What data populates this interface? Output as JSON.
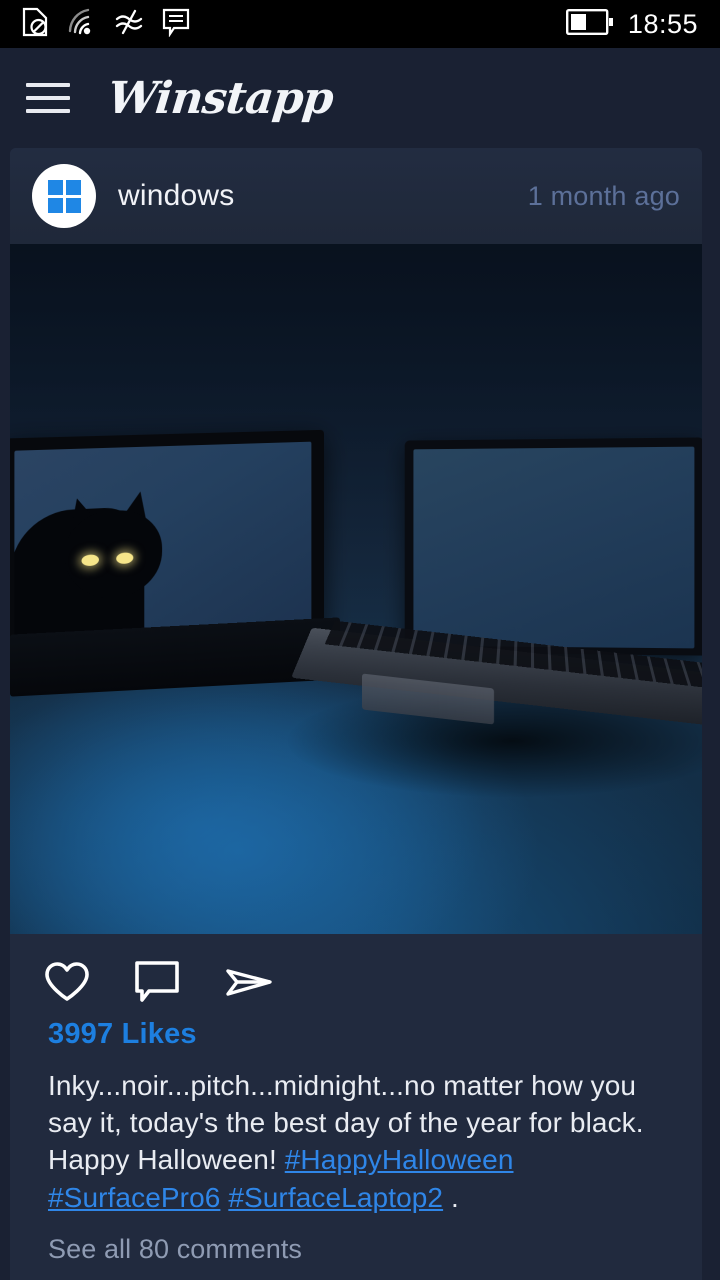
{
  "status_bar": {
    "icons": [
      "no-sim-icon",
      "wifi-icon",
      "cellular-data-icon",
      "message-icon"
    ],
    "battery": {
      "icon": "battery-icon",
      "level_percent": 42
    },
    "clock": "18:55"
  },
  "app_bar": {
    "menu_icon": "hamburger-menu-icon",
    "brand": "Winstapp"
  },
  "post": {
    "avatar_icon": "windows-logo-icon",
    "username": "windows",
    "timestamp": "1 month ago",
    "photo": {
      "alt": "Dark blue night scene with a black cat with glowing eyes behind a Surface Studio and a Surface Laptop on a desk"
    },
    "actions": [
      {
        "name": "like-button",
        "icon": "heart-icon"
      },
      {
        "name": "comment-button",
        "icon": "comment-bubble-icon"
      },
      {
        "name": "share-button",
        "icon": "paper-plane-icon"
      }
    ],
    "likes": "3997 Likes",
    "caption_parts": [
      {
        "type": "text",
        "value": "Inky...noir...pitch...midnight...no matter how you say it, today's the best day of the year for black. Happy Halloween! "
      },
      {
        "type": "hashtag",
        "value": "#HappyHalloween"
      },
      {
        "type": "text",
        "value": " "
      },
      {
        "type": "hashtag",
        "value": "#SurfacePro6"
      },
      {
        "type": "text",
        "value": " "
      },
      {
        "type": "hashtag",
        "value": "#SurfaceLaptop2"
      },
      {
        "type": "text",
        "value": " ."
      }
    ],
    "caption_plain": "Inky...noir...pitch...midnight...no matter how you say it, today's the best day of the year for black. Happy Halloween! #HappyHalloween #SurfacePro6 #SurfaceLaptop2 .",
    "comments_link": "See all 80 comments"
  },
  "colors": {
    "page_background": "#1a2133",
    "card_background": "#212a3e",
    "status_bar_background": "#000000",
    "accent_blue": "#1d7fe0",
    "hashtag_blue": "#2f86e8",
    "timestamp_blue": "#5c7099",
    "muted_text": "#8f9bb3",
    "primary_text": "#e9ecf2",
    "windows_logo_blue": "#1f87e5"
  }
}
